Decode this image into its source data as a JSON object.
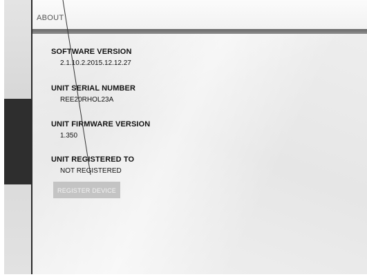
{
  "header": {
    "title": "ABOUT"
  },
  "sections": [
    {
      "label": "SOFTWARE VERSION",
      "value": "2.1.10.2.2015.12.12.27"
    },
    {
      "label": "UNIT SERIAL NUMBER",
      "value": "REE20RHOL23A"
    },
    {
      "label": "UNIT FIRMWARE VERSION",
      "value": "1.350"
    },
    {
      "label": "UNIT REGISTERED TO",
      "value": "NOT REGISTERED"
    }
  ],
  "register_button": {
    "label": "REGISTER DEVICE"
  },
  "colors": {
    "sidebar_tab": "#2e2e2e",
    "header_bar": "#6a6a6a",
    "button_bg": "#c4c4c4"
  }
}
